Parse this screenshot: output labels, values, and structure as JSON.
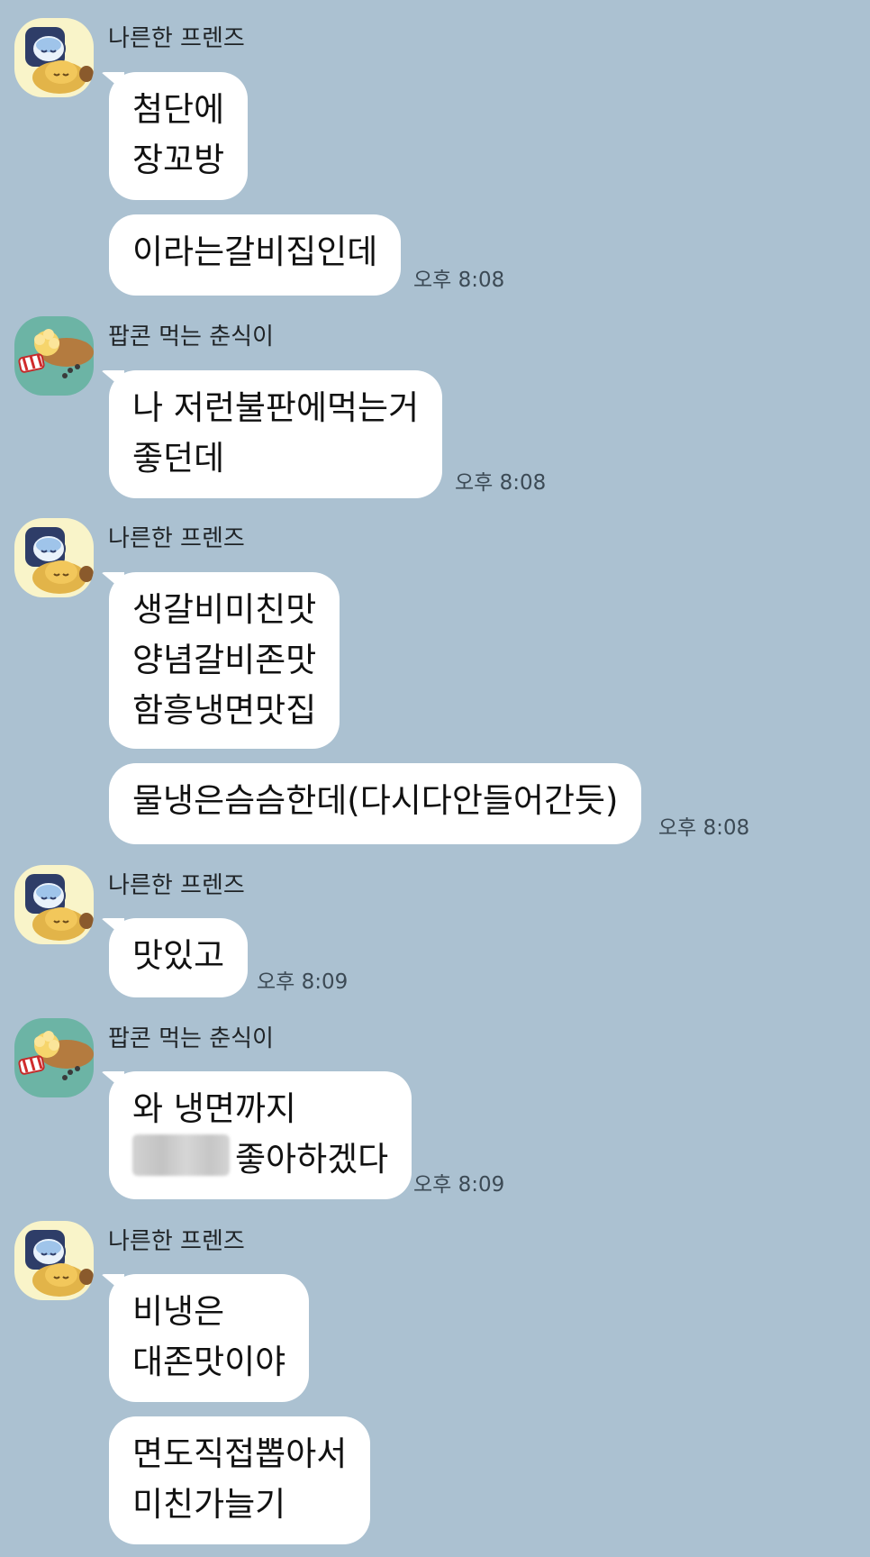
{
  "senders": {
    "a": "나른한 프렌즈",
    "b": "팝콘 먹는 춘식이"
  },
  "messages": [
    {
      "lines": [
        "첨단에",
        "장꼬방"
      ]
    },
    {
      "lines": [
        "이라는갈비집인데"
      ],
      "time": "오후 8:08"
    },
    {
      "lines": [
        "나 저런불판에먹는거",
        "좋던데"
      ],
      "time": "오후 8:08"
    },
    {
      "lines": [
        "생갈비미친맛",
        "양념갈비존맛",
        "함흥냉면맛집"
      ]
    },
    {
      "lines": [
        "물냉은슴슴한데(다시다안들어간듯)"
      ],
      "time": "오후 8:08"
    },
    {
      "lines": [
        "맛있고"
      ],
      "time": "오후 8:09"
    },
    {
      "lines": [
        "와 냉면까지",
        "좋아하겠다"
      ],
      "time": "오후 8:09"
    },
    {
      "lines": [
        "비냉은",
        "대존맛이야"
      ]
    },
    {
      "lines": [
        "면도직접뽑아서",
        "미친가늘기"
      ]
    }
  ],
  "colors": {
    "background": "#abc1d1",
    "bubble": "#ffffff",
    "avatar_a_bg": "#f9f4c9",
    "avatar_b_bg": "#6cb4a5"
  },
  "icons": {
    "avatar_a": "sleepy-friends-avatar-icon",
    "avatar_b": "popcorn-chunsik-avatar-icon"
  }
}
